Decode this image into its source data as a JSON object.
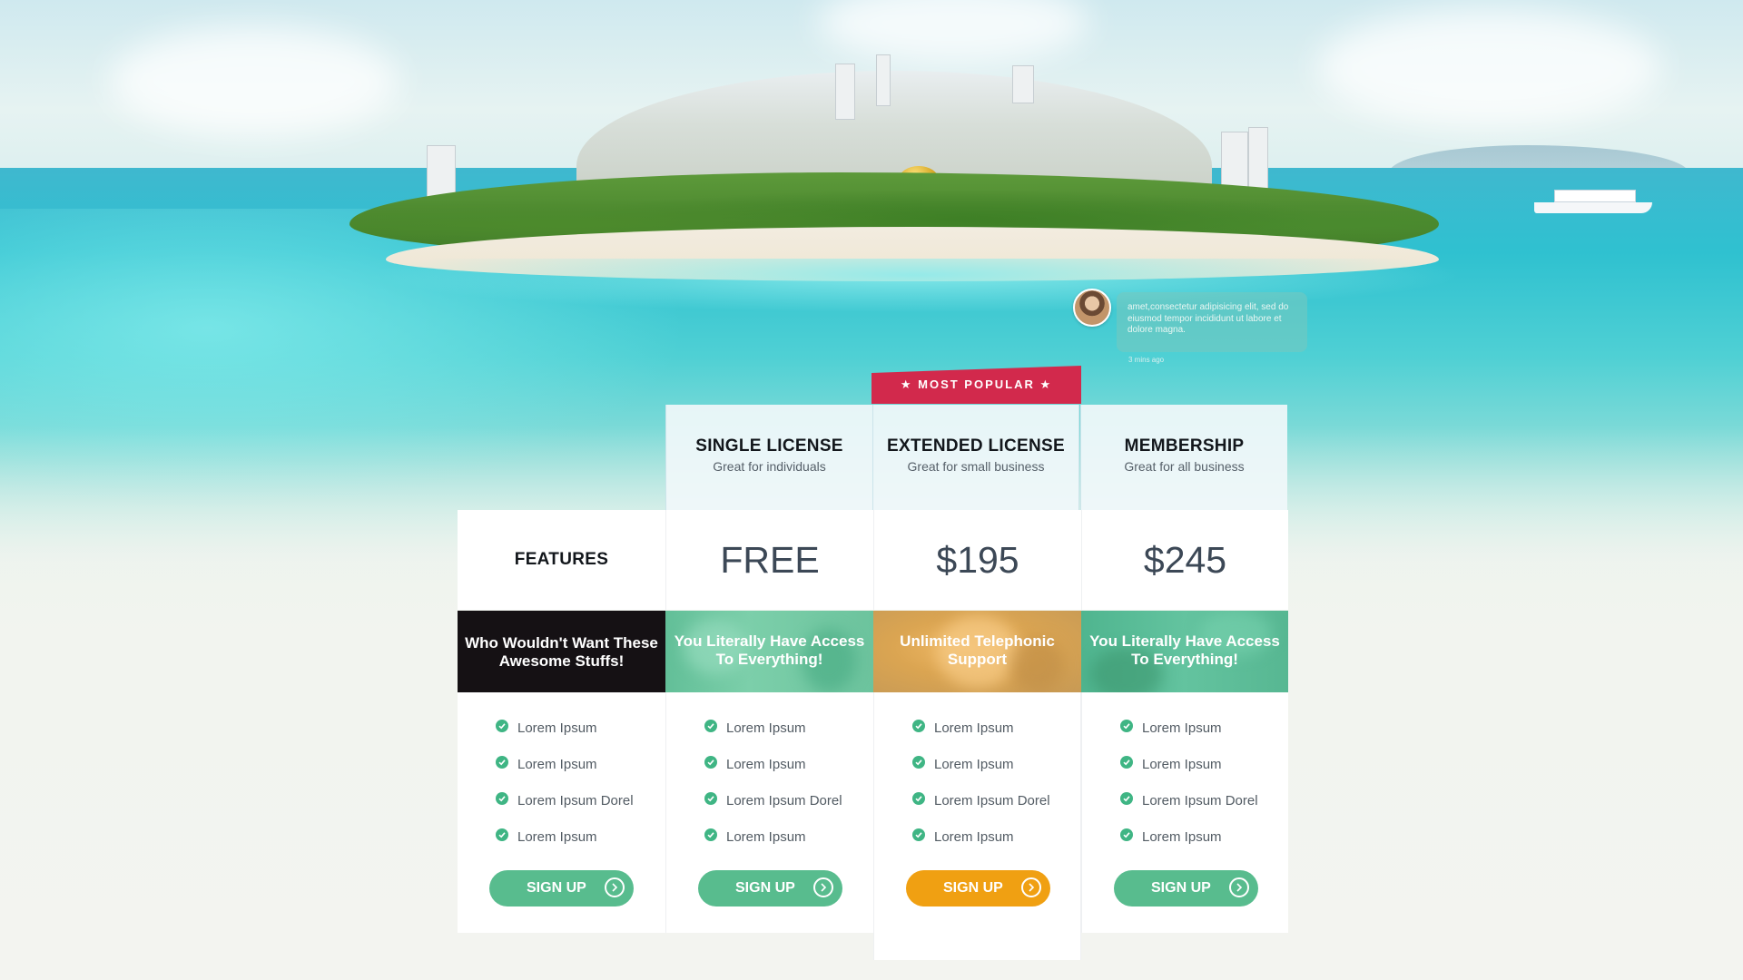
{
  "chat": {
    "message": "amet,consectetur adipisicing elit, sed do eiusmod tempor incididunt ut labore et dolore magna.",
    "time": "3 mins ago"
  },
  "ribbon": {
    "label": "★ MOST POPULAR ★",
    "color": "#d2294c"
  },
  "features": {
    "title": "FEATURES",
    "banner": "Who Wouldn't Want These Awesome Stuffs!"
  },
  "plans": [
    {
      "name": "SINGLE LICENSE",
      "subtitle": "Great for individuals",
      "price": "FREE",
      "banner": "You Literally Have Access To Everything!",
      "features": [
        "Lorem Ipsum",
        "Lorem Ipsum",
        "Lorem Ipsum Dorel",
        "Lorem Ipsum"
      ],
      "cta": "SIGN UP"
    },
    {
      "name": "EXTENDED LICENSE",
      "subtitle": "Great for small business",
      "price": "$195",
      "banner": "Unlimited Telephonic Support",
      "features": [
        "Lorem Ipsum",
        "Lorem Ipsum",
        "Lorem Ipsum Dorel",
        "Lorem Ipsum"
      ],
      "cta": "SIGN UP"
    },
    {
      "name": "MEMBERSHIP",
      "subtitle": "Great for all business",
      "price": "$245",
      "banner": "You Literally Have Access To Everything!",
      "features": [
        "Lorem Ipsum",
        "Lorem Ipsum",
        "Lorem Ipsum Dorel",
        "Lorem Ipsum"
      ],
      "cta": "SIGN UP"
    }
  ],
  "feature_column": {
    "items": [
      "Lorem Ipsum",
      "Lorem Ipsum",
      "Lorem Ipsum Dorel",
      "Lorem Ipsum"
    ],
    "cta": "SIGN UP"
  },
  "colors": {
    "accent_green": "#58bc8e",
    "accent_orange": "#f0a012",
    "check_green": "#3fb584",
    "dark_banner": "#151114"
  },
  "icons": {
    "check": "check-circle-icon",
    "arrow": "chevron-right-circle-icon",
    "star": "star-icon"
  }
}
